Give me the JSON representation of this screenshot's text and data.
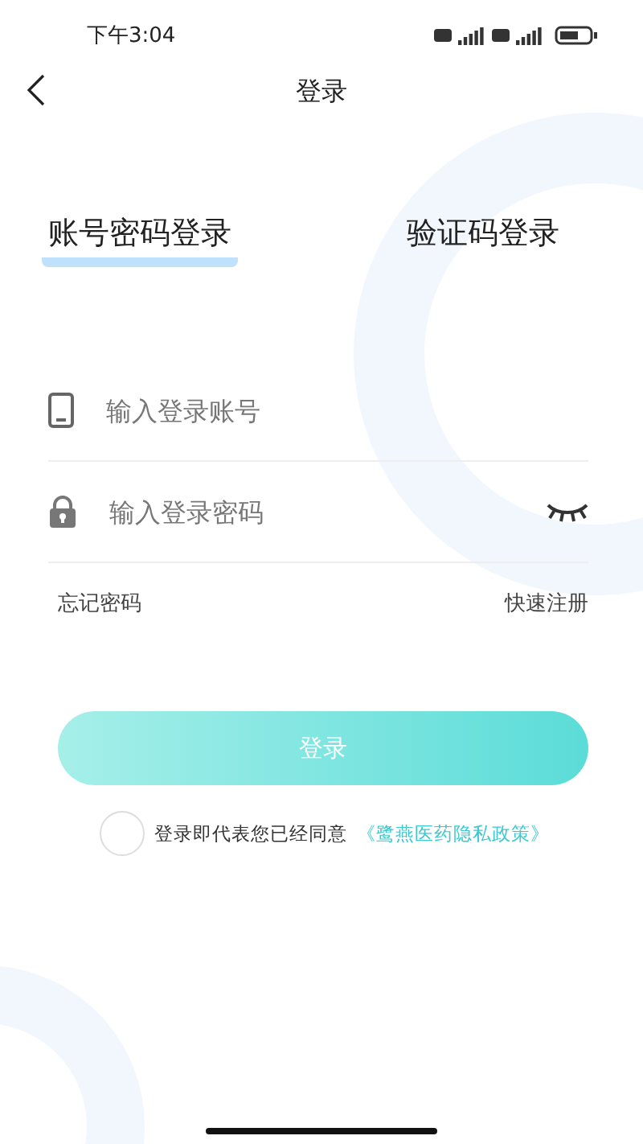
{
  "status_bar": {
    "time": "下午3:04"
  },
  "nav": {
    "title": "登录"
  },
  "tabs": [
    {
      "label": "账号密码登录",
      "selected": true
    },
    {
      "label": "验证码登录",
      "selected": false
    }
  ],
  "fields": [
    {
      "kind": "account",
      "placeholder": "输入登录账号"
    },
    {
      "kind": "password",
      "placeholder": "输入登录密码",
      "password_visible": false
    }
  ],
  "links": {
    "forgot": "忘记密码",
    "register": "快速注册"
  },
  "login_button": "登录",
  "agreement": {
    "checked": false,
    "text": "登录即代表您已经同意",
    "policy_link": "《鹭燕医药隐私政策》"
  }
}
